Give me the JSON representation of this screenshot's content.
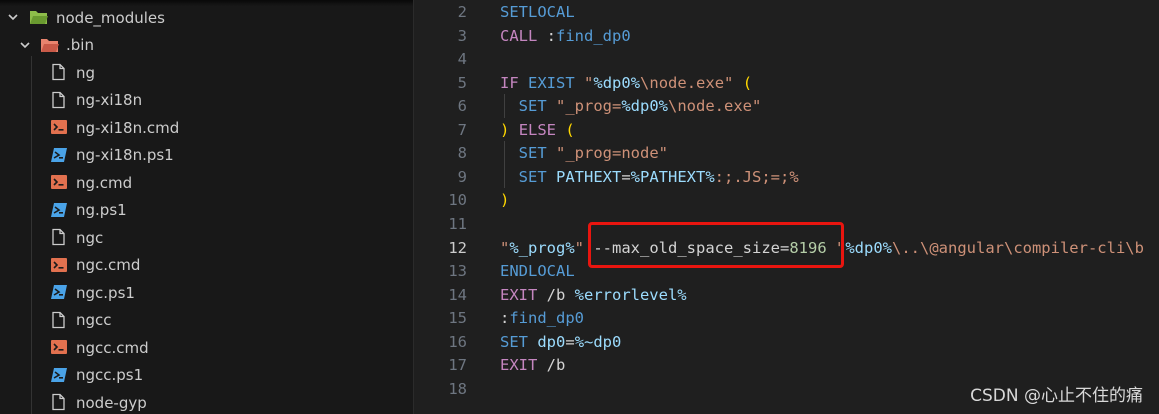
{
  "explorer": {
    "items": [
      {
        "label": "node_modules",
        "kind": "folder-open"
      },
      {
        "label": ".bin",
        "kind": "folder-bin"
      },
      {
        "label": "ng",
        "kind": "file"
      },
      {
        "label": "ng-xi18n",
        "kind": "file"
      },
      {
        "label": "ng-xi18n.cmd",
        "kind": "cmd"
      },
      {
        "label": "ng-xi18n.ps1",
        "kind": "ps1"
      },
      {
        "label": "ng.cmd",
        "kind": "cmd"
      },
      {
        "label": "ng.ps1",
        "kind": "ps1"
      },
      {
        "label": "ngc",
        "kind": "file"
      },
      {
        "label": "ngc.cmd",
        "kind": "cmd"
      },
      {
        "label": "ngc.ps1",
        "kind": "ps1"
      },
      {
        "label": "ngcc",
        "kind": "file"
      },
      {
        "label": "ngcc.cmd",
        "kind": "cmd"
      },
      {
        "label": "ngcc.ps1",
        "kind": "ps1"
      },
      {
        "label": "node-gyp",
        "kind": "file"
      }
    ]
  },
  "editor": {
    "active_line": "12",
    "lines": [
      {
        "n": "2",
        "tokens": [
          [
            "SETLOCAL",
            "cmd"
          ]
        ]
      },
      {
        "n": "3",
        "tokens": [
          [
            "CALL",
            "kw"
          ],
          [
            " :",
            "plain"
          ],
          [
            "find_dp0",
            "cmd"
          ]
        ]
      },
      {
        "n": "4",
        "tokens": []
      },
      {
        "n": "5",
        "tokens": [
          [
            "IF",
            "kw"
          ],
          [
            " ",
            "plain"
          ],
          [
            "EXIST",
            "cmd"
          ],
          [
            " ",
            "plain"
          ],
          [
            "\"",
            "str"
          ],
          [
            "%dp0%",
            "var"
          ],
          [
            "\\node.exe\"",
            "str"
          ],
          [
            " ",
            "plain"
          ],
          [
            "(",
            "br"
          ]
        ]
      },
      {
        "n": "6",
        "tokens": [
          [
            "  ",
            "plain"
          ],
          [
            "SET",
            "cmd"
          ],
          [
            " \"_prog=",
            "str"
          ],
          [
            "%dp0%",
            "var"
          ],
          [
            "\\node.exe\"",
            "str"
          ]
        ]
      },
      {
        "n": "7",
        "tokens": [
          [
            ")",
            "br"
          ],
          [
            " ",
            "plain"
          ],
          [
            "ELSE",
            "kw"
          ],
          [
            " ",
            "plain"
          ],
          [
            "(",
            "br"
          ]
        ]
      },
      {
        "n": "8",
        "tokens": [
          [
            "  ",
            "plain"
          ],
          [
            "SET",
            "cmd"
          ],
          [
            " \"_prog=node\"",
            "str"
          ]
        ]
      },
      {
        "n": "9",
        "tokens": [
          [
            "  ",
            "plain"
          ],
          [
            "SET",
            "cmd"
          ],
          [
            " PATHEXT",
            "var"
          ],
          [
            "=",
            "op"
          ],
          [
            "%PATHEXT%",
            "var"
          ],
          [
            ":;.JS;=;%",
            "str"
          ]
        ]
      },
      {
        "n": "10",
        "tokens": [
          [
            ")",
            "br"
          ]
        ]
      },
      {
        "n": "11",
        "tokens": []
      },
      {
        "n": "12",
        "tokens": [
          [
            "\"",
            "str"
          ],
          [
            "%_prog%",
            "var"
          ],
          [
            "\"",
            "str"
          ],
          [
            " --max_old_space_size=",
            "plain"
          ],
          [
            "8196",
            "num"
          ],
          [
            " \"",
            "str"
          ],
          [
            "%dp0%",
            "var"
          ],
          [
            "\\..\\@angular\\compiler-cli\\b",
            "str"
          ]
        ]
      },
      {
        "n": "13",
        "tokens": [
          [
            "ENDLOCAL",
            "cmd"
          ]
        ]
      },
      {
        "n": "14",
        "tokens": [
          [
            "EXIT",
            "kw"
          ],
          [
            " /b ",
            "plain"
          ],
          [
            "%errorlevel%",
            "var"
          ]
        ]
      },
      {
        "n": "15",
        "tokens": [
          [
            ":",
            "plain"
          ],
          [
            "find_dp0",
            "cmd"
          ]
        ]
      },
      {
        "n": "16",
        "tokens": [
          [
            "SET",
            "cmd"
          ],
          [
            " ",
            "plain"
          ],
          [
            "dp0",
            "var"
          ],
          [
            "=",
            "op"
          ],
          [
            "%~dp0",
            "var"
          ]
        ]
      },
      {
        "n": "17",
        "tokens": [
          [
            "EXIT",
            "kw"
          ],
          [
            " /b",
            "plain"
          ]
        ]
      },
      {
        "n": "18",
        "tokens": []
      }
    ]
  },
  "watermark": "CSDN @心止不住的痛",
  "colors": {
    "highlight_border": "#e8150f",
    "cmd_file_icon": "#e2714f",
    "ps1_file_icon": "#4aa3e8",
    "folder_icon": "#8ebd4a",
    "bin_folder_icon": "#e8846e"
  }
}
